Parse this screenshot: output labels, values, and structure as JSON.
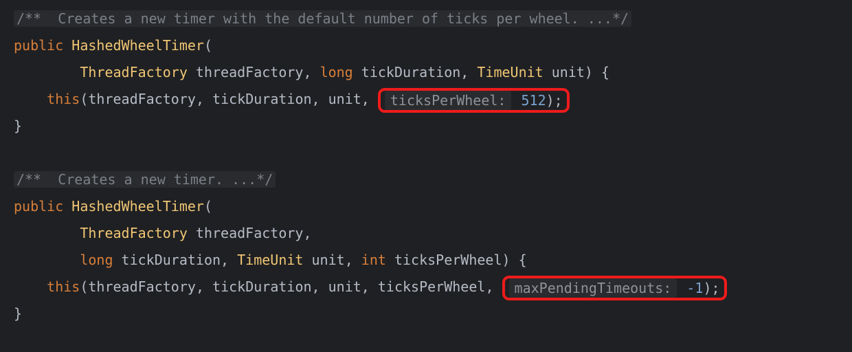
{
  "colors": {
    "keyword": "#d87f3a",
    "class": "#f0c674",
    "number": "#7aa2cf",
    "identifier": "#b6bcc6",
    "comment": "#7b8088",
    "hint": "#8e9299",
    "highlight_border": "#ef1b1b"
  },
  "block1": {
    "comment": "/**  Creates a new timer with the default number of ticks per wheel. ...*/",
    "kw_public": "public",
    "method_name": "HashedWheelTimer",
    "open_paren": "(",
    "type_threadfactory": "ThreadFactory",
    "param_threadfactory": "threadFactory",
    "kw_long": "long",
    "param_tickduration": "tickDuration",
    "type_timeunit": "TimeUnit",
    "param_unit": "unit",
    "close_sig": ") {",
    "kw_this": "this",
    "call_open": "(",
    "arg1": "threadFactory",
    "arg2": "tickDuration",
    "arg3": "unit",
    "hint_label": "ticksPerWheel:",
    "hint_value": "512",
    "call_close": ");",
    "brace_close": "}"
  },
  "block2": {
    "comment": "/**  Creates a new timer. ...*/",
    "kw_public": "public",
    "method_name": "HashedWheelTimer",
    "open_paren": "(",
    "type_threadfactory": "ThreadFactory",
    "param_threadfactory": "threadFactory",
    "kw_long": "long",
    "param_tickduration": "tickDuration",
    "type_timeunit": "TimeUnit",
    "param_unit": "unit",
    "kw_int": "int",
    "param_tickswheel": "ticksPerWheel",
    "close_sig": ") {",
    "kw_this": "this",
    "call_open": "(",
    "arg1": "threadFactory",
    "arg2": "tickDuration",
    "arg3": "unit",
    "arg4": "ticksPerWheel",
    "hint_label": "maxPendingTimeouts:",
    "hint_value": "-1",
    "call_close": ");",
    "brace_close": "}"
  },
  "punct": {
    "comma": ", ",
    "comma_trail": ",",
    "indent4": "    ",
    "indent8": "        ",
    "space": " "
  }
}
